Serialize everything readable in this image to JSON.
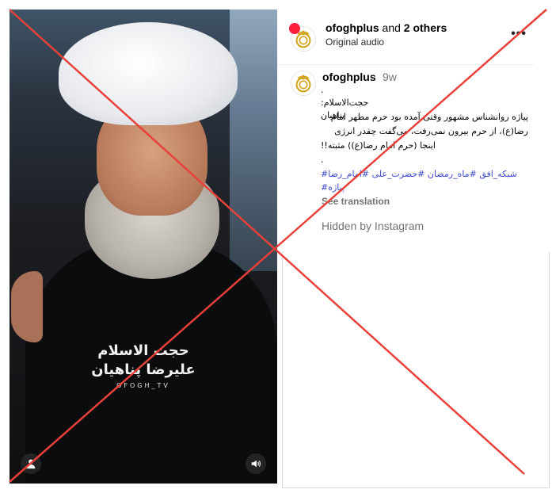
{
  "post": {
    "header": {
      "username": "ofoghplus",
      "coauthors": "and 2 others",
      "audio": "Original audio",
      "more": "•••"
    },
    "caption_user": "ofoghplus",
    "time_ago": "9w",
    "caption_lines": [
      ".",
      ":حجت‌الاسلام پناهیان",
      "پیاژه روانشناس مشهور وقتی آمده بود حرم مطهر امام",
      "رضا(ع)، از حرم بیرون نمی‌رفت، می‌گفت چقدر انرژی",
      "!!اینجا (حرم امام رضا(ع)) مثبته",
      "."
    ],
    "hashtag_lines": [
      "#شبکه_افق #ماه_رمضان #حضرت_علی #امام_رضا",
      "#پیاژه"
    ],
    "see_translation": "See translation",
    "hidden_notice": "Hidden by Instagram"
  },
  "video": {
    "caption_title": "حجت الاسلام",
    "caption_name": "علیرضا پناهیان",
    "caption_channel": "OFOGH_TV"
  },
  "colors": {
    "cross": "#e8413a",
    "hashtag": "#3b49c9",
    "badge": "#ff1e3c",
    "logo": "#d4a41c"
  },
  "icons": {
    "profile": "person-icon",
    "sound": "speaker-icon",
    "more": "more-dots-icon"
  }
}
